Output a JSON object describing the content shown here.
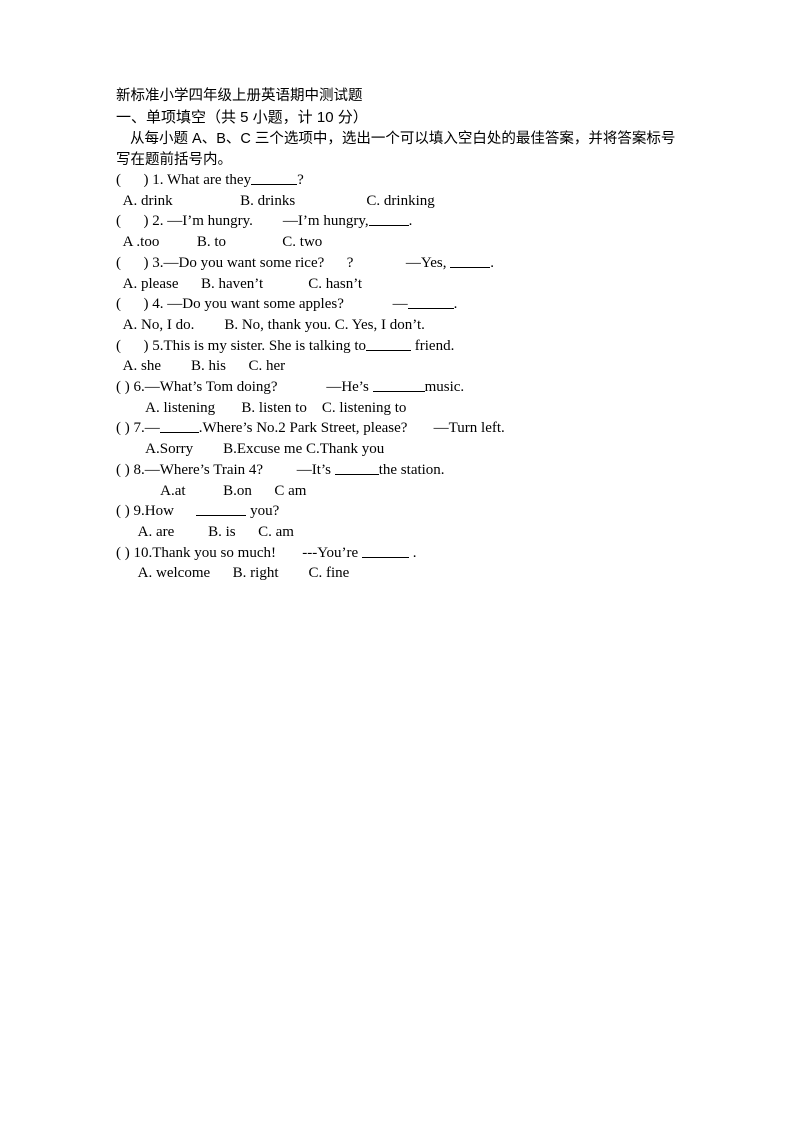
{
  "document": {
    "title": "新标准小学四年级上册英语期中测试题",
    "section_heading": "一、单项填空（共 5 小题，计 10 分）",
    "instruction": "从每小题 A、B、C 三个选项中，选出一个可以填入空白处的最佳答案，并将答案标号写在题前括号内。",
    "questions": [
      {
        "stem": "（    ）1. What are they______?",
        "stem_pre": "(      ) 1. What are they",
        "stem_post": "?",
        "options": "  A. drink                  B. drinks                   C. drinking"
      },
      {
        "stem_pre": "(      ) 2. —I’m hungry.        —I’m hungry,",
        "stem_post": ".",
        "options": "  A .too          B. to               C. two"
      },
      {
        "stem_pre": "(      ) 3.—Do you want some rice?      ?              —Yes, ",
        "stem_post": ".",
        "options": "  A. please      B. haven’t            C. hasn’t"
      },
      {
        "stem_pre": "(      ) 4. —Do you want some apples?             —",
        "stem_post": ".",
        "options": "  A. No, I do.        B. No, thank you. C. Yes, I don’t."
      },
      {
        "stem_pre": "(      ) 5.This is my sister. She is talking to",
        "stem_post": " friend.",
        "options": "  A. she        B. his      C. her"
      },
      {
        "stem_pre": "( ) 6.—What’s Tom doing?             —He’s ",
        "stem_post": "music.",
        "options": "        A. listening       B. listen to    C. listening to"
      },
      {
        "stem_pre": "( ) 7.—",
        "stem_post": ".Where’s No.2 Park Street, please?       —Turn left.",
        "options": "        A.Sorry        B.Excuse me C.Thank you"
      },
      {
        "stem_pre": "( ) 8.—Where’s Train 4?         —It’s ",
        "stem_post": "the station.",
        "options": "            A.at          B.on      C am"
      },
      {
        "stem_pre": "( ) 9.How      ",
        "stem_post": " you?",
        "options": "      A. are         B. is      C. am"
      },
      {
        "stem_pre": "( ) 10.Thank you so much!       ---You’re ",
        "stem_post": " .",
        "options": "      A. welcome      B. right        C. fine"
      }
    ]
  }
}
